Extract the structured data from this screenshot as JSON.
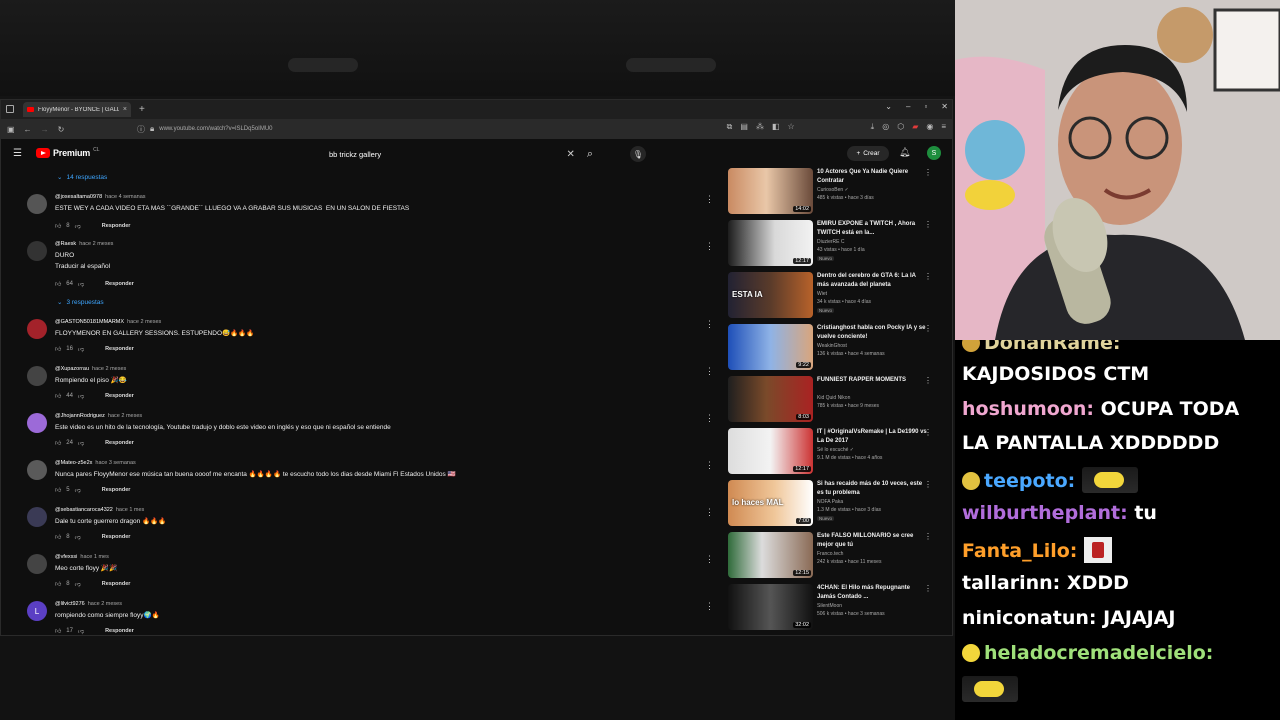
{
  "browser": {
    "tab_title": "FloyyMenor - BYONCE | GALLE",
    "url": "www.youtube.com/watch?v=lSLDq5oIMU0"
  },
  "youtube": {
    "logo_text": "Premium",
    "logo_superscript": "CL",
    "search_query": "bb trickz gallery",
    "create_label": "Crear",
    "avatar_letter": "S"
  },
  "comments": {
    "replies_links": [
      "14 respuestas",
      "3 respuestas"
    ],
    "reply_label": "Responder",
    "items": [
      {
        "author": "@josesaltama0978",
        "when": "hace 4 semanas",
        "text": "ESTE WEY A CADA VIDEO ETA MAS ``GRANDE´´ LLUEGO VA A GRABAR SUS MUSICAS  EN UN SALON DE FIESTAS",
        "likes": "8",
        "avatar_color": "#555"
      },
      {
        "author": "@Raesk",
        "when": "hace 2 meses",
        "text": "DURO\nTraducir al español",
        "likes": "64",
        "avatar_color": "#333"
      },
      {
        "author": "@GASTON50181MMARMX",
        "when": "hace 2 meses",
        "text": "FLOYYMENOR EN GALLERY SESSIONS. ESTUPENDO😅🔥🔥🔥",
        "likes": "16",
        "avatar_color": "#a3222a"
      },
      {
        "author": "@Xupazorrau",
        "when": "hace 2 meses",
        "text": "Rompiendo el piso 🎉😂",
        "likes": "44",
        "avatar_color": "#444"
      },
      {
        "author": "@JhojannRodriguez",
        "when": "hace 2 meses",
        "text": "Este video es un hito de la tecnología, Youtube tradujo y doblo este video en inglés y eso que ni español se entiende",
        "likes": "24",
        "avatar_color": "#9c6ad8"
      },
      {
        "author": "@Mateo-z5e2x",
        "when": "hace 3 semanas",
        "text": "Nunca pares FloyyMenor ese música tan buena oooof me encanta 🔥🔥🔥🔥 te escucho todo los dias desde Miami Fl Estados Unidos 🇺🇸",
        "likes": "5",
        "avatar_color": "#5a5a5a"
      },
      {
        "author": "@sebastiancaroca4322",
        "when": "hace 1 mes",
        "text": "Dale tu corte guerrero dragon 🔥🔥🔥",
        "likes": "8",
        "avatar_color": "#3a3a55"
      },
      {
        "author": "@vfexssi",
        "when": "hace 1 mes",
        "text": "Meo corte floyy 🎉🎉",
        "likes": "8",
        "avatar_color": "#444"
      },
      {
        "author": "@lilvict9276",
        "when": "hace 2 meses",
        "text": "rompiendo como siempre floyy🌍🔥",
        "likes": "17",
        "avatar_color": "#5b3fc4",
        "avatar_letter": "L"
      }
    ]
  },
  "sidebar": {
    "videos": [
      {
        "title": "10 Actores Que Ya Nadie Quiere Contratar",
        "channel": "CuriosoBen ✓",
        "stats": "485 k vistas • hace 3 días",
        "duration": "14:02",
        "is_new": false,
        "thumb": "linear-gradient(90deg,#c98a62,#e9c7a8 45%,#6a4a3a)"
      },
      {
        "title": "EMIRU EXPONE a TWITCH , Ahora TWITCH está en la...",
        "channel": "DiuzierRE C",
        "stats": "43 vistas • hace 1 día",
        "duration": "12:17",
        "is_new": true,
        "thumb": "linear-gradient(90deg,#1d1d1d,#d9d9d9 55%,#f2f2f2)"
      },
      {
        "title": "Dentro del cerebro de GTA 6: La IA más avanzada del planeta",
        "channel": "Wiet",
        "stats": "34 k vistas • hace 4 días",
        "duration": "",
        "is_new": true,
        "thumb": "linear-gradient(90deg,#223 0%,#5a3b2a 50%,#b8622a)",
        "overlay": "ESTA IA"
      },
      {
        "title": "Cristianghost habla con Pocky IA y se vuelve conciente!",
        "channel": "WeakinGhost",
        "stats": "136 k vistas • hace 4 semanas",
        "duration": "9:22",
        "is_new": false,
        "thumb": "linear-gradient(90deg,#1e4fb8,#8fb3e6 50%,#d9a57c)"
      },
      {
        "title": "FUNNIEST RAPPER MOMENTS",
        "channel": "Kid Quid Nikon",
        "stats": "785 k vistas • hace 9 meses",
        "duration": "8:03",
        "is_new": false,
        "thumb": "linear-gradient(90deg,#1f1f1f,#7a4a2a 45%,#a22)"
      },
      {
        "title": "IT | #OriginalVsRemake | La De1990 vs La De 2017",
        "channel": "Sé lo escuché ✓",
        "stats": "9.1 M de vistas • hace 4 años",
        "duration": "12:17",
        "is_new": false,
        "thumb": "linear-gradient(90deg,#ddd,#f3f3f3 50%,#c33)"
      },
      {
        "title": "Si has recaido más de 10 veces, este es tu problema",
        "channel": "NOFA Paka",
        "stats": "1.3 M de vistas • hace 3 días",
        "duration": "7:00",
        "is_new": true,
        "thumb": "linear-gradient(90deg,#d08a52,#f0c79a 55%,#fff)",
        "overlay": "lo haces MAL"
      },
      {
        "title": "Este FALSO MILLONARIO se cree mejor que tú",
        "channel": "Franco.tech",
        "stats": "242 k vistas • hace 11 meses",
        "duration": "12:15",
        "is_new": false,
        "thumb": "linear-gradient(90deg,#2f6b3a,#dcdcdc 40%,#8a6a55)"
      },
      {
        "title": "4CHAN: El Hilo más Repugnante Jamás Contado ...",
        "channel": "SilentMoon",
        "stats": "506 k vistas • hace 3 semanas",
        "duration": "32:02",
        "is_new": false,
        "thumb": "linear-gradient(90deg,#111,#555 50%,#111)"
      }
    ]
  },
  "chat": {
    "lines": [
      {
        "user": "DonanRame:",
        "msg": "",
        "user_color": "#e0d39b",
        "emote": "#d1a23a"
      },
      {
        "user": "",
        "msg": "KAJDOSIDOS CTM",
        "user_color": "#fff"
      },
      {
        "user": "hoshumoon:",
        "msg": "OCUPA TODA",
        "user_color": "#f0a7d0"
      },
      {
        "user": "",
        "msg": "LA PANTALLA XDDDDDD",
        "user_color": "#fff"
      },
      {
        "user": "teepoto:",
        "msg": "",
        "user_color": "#4aa8ff",
        "emote": "#e2c240",
        "wide_emote": true
      },
      {
        "user": "wilburtheplant:",
        "msg": "tu",
        "user_color": "#b16ddb"
      },
      {
        "user": "Fanta_Lilo:",
        "msg": "",
        "user_color": "#ff9f2a",
        "chair_emote": true
      },
      {
        "user": "tallarinn:",
        "msg": "XDDD",
        "user_color": "#fff"
      },
      {
        "user": "niniconatun:",
        "msg": "JAJAJAJ",
        "user_color": "#fff"
      },
      {
        "user": "heladocremadelcielo:",
        "msg": "",
        "user_color": "#9fe07a",
        "emote": "#f2d63b"
      }
    ]
  }
}
